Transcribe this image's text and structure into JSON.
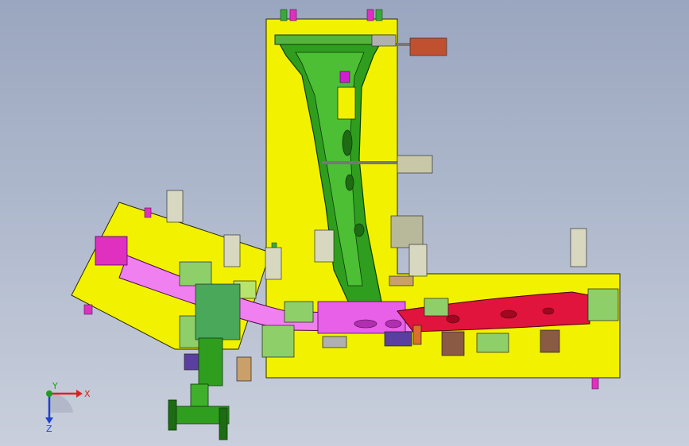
{
  "viewport": {
    "background_top": "#9aa6bf",
    "background_bottom": "#c9cfdc"
  },
  "colors": {
    "base_plate": "#f2f200",
    "base_outline": "#2a2a00",
    "part_green": "#2f9e1e",
    "part_green_dark": "#1d6b12",
    "part_pink": "#f07ff0",
    "part_magenta": "#d01fd0",
    "part_red": "#e0143c",
    "clamp_gray": "#b8b89a",
    "bracket_green": "#8fcf6a",
    "bracket_lime": "#b7e36f",
    "block_purple": "#5b3fa0",
    "block_tan": "#c9a06a",
    "block_orange": "#d9702a",
    "cylinder_brown": "#8a5a44",
    "axis_x": "#e02020",
    "axis_y": "#1e9e1e",
    "axis_z": "#2040d0"
  },
  "triad": {
    "x_label": "X",
    "y_label": "Y",
    "z_label": "Z"
  }
}
